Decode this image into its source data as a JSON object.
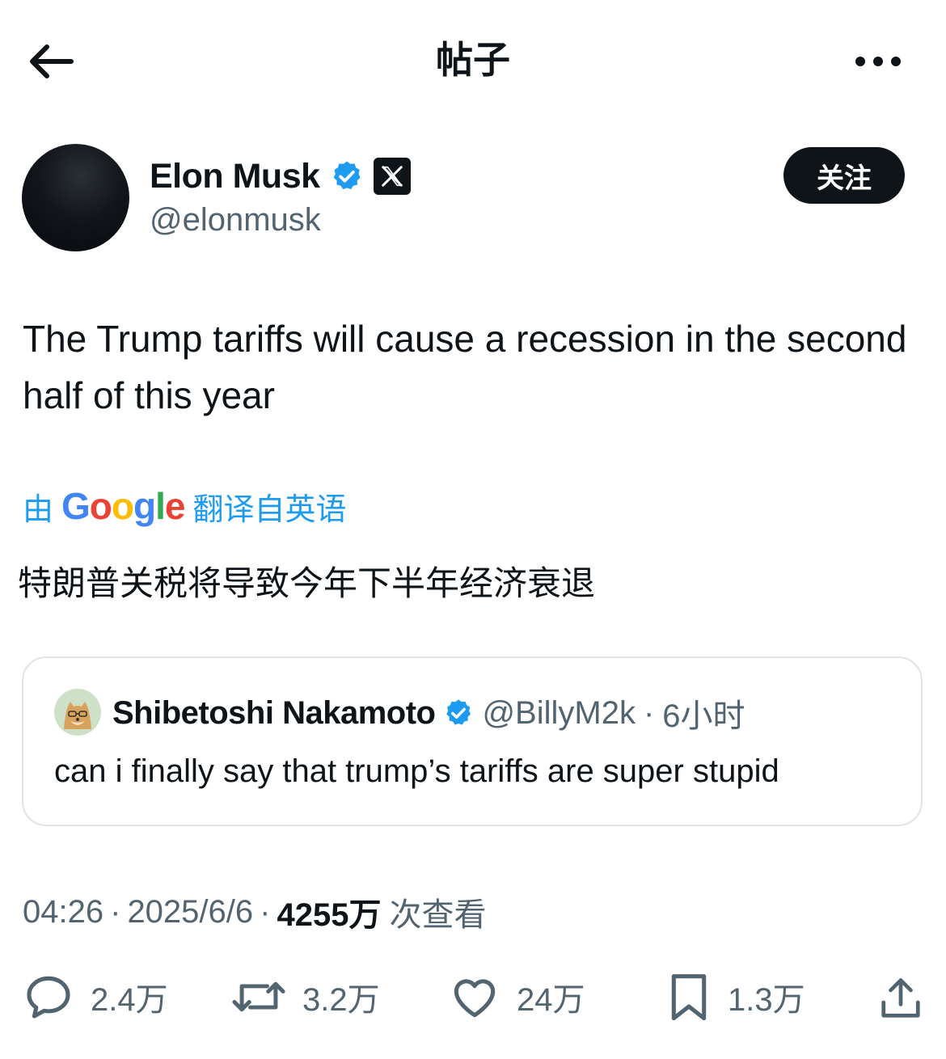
{
  "header": {
    "title": "帖子",
    "back_icon": "arrow-left-icon",
    "more_icon": "more-dots-icon"
  },
  "author": {
    "name": "Elon Musk",
    "handle": "@elonmusk",
    "verified_icon": "verified-badge-icon",
    "affiliation_icon": "x-logo-icon",
    "follow_label": "关注"
  },
  "tweet": {
    "text": "The Trump tariffs will cause a recession in the second half of this year",
    "translation": {
      "prefix": "由",
      "provider": "Google",
      "suffix": "翻译自英语",
      "text": "特朗普关税将导致今年下半年经济衰退"
    }
  },
  "quote": {
    "name": "Shibetoshi Nakamoto",
    "handle": "@BillyM2k",
    "separator": "·",
    "time": "6小时",
    "text": "can i finally say that trump’s tariffs are super stupid"
  },
  "meta": {
    "time": "04:26",
    "date": "2025/6/6",
    "views_count": "4255万",
    "views_label": "次查看",
    "separator": "·"
  },
  "actions": {
    "replies": "2.4万",
    "retweets": "3.2万",
    "likes": "24万",
    "bookmarks": "1.3万"
  },
  "colors": {
    "accent": "#1d9bf0",
    "text": "#0f1419",
    "muted": "#536471",
    "border": "#dfe4e8"
  }
}
